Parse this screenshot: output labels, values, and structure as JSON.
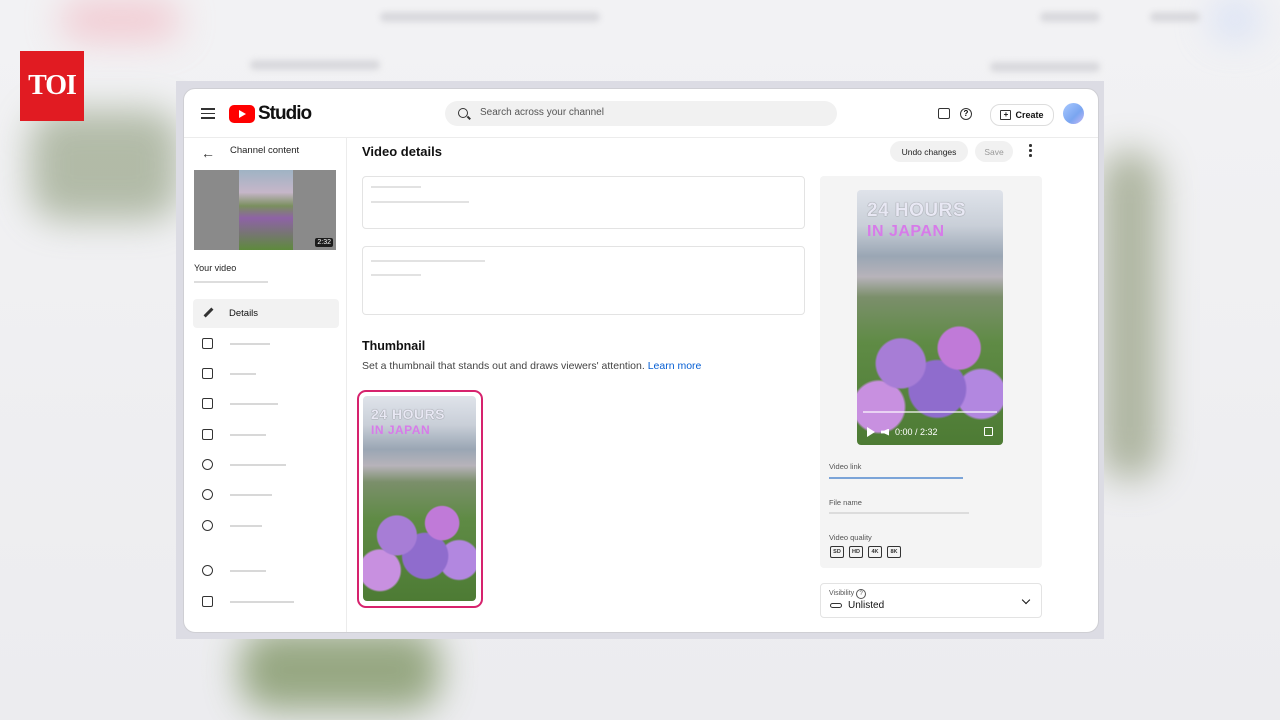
{
  "brand": {
    "logo_text": "TOI",
    "accent": "#e11b22"
  },
  "header": {
    "app_name": "Studio",
    "search_placeholder": "Search across your channel",
    "create_label": "Create"
  },
  "sidebar": {
    "back_label": "Channel content",
    "video_duration": "2:32",
    "your_video_label": "Your video",
    "items": [
      {
        "label": "Details",
        "icon": "pencil-icon",
        "active": true
      },
      {
        "label": "",
        "icon": "analytics-icon"
      },
      {
        "label": "",
        "icon": "editor-icon"
      },
      {
        "label": "",
        "icon": "comments-icon"
      },
      {
        "label": "",
        "icon": "subtitles-icon"
      },
      {
        "label": "",
        "icon": "earn-icon"
      },
      {
        "label": "",
        "icon": "copyright-icon"
      },
      {
        "label": "",
        "icon": "clips-icon"
      },
      {
        "label": "",
        "icon": "settings-icon"
      },
      {
        "label": "",
        "icon": "feedback-icon"
      }
    ]
  },
  "main": {
    "title": "Video details",
    "undo_label": "Undo changes",
    "save_label": "Save",
    "thumbnail_title": "Thumbnail",
    "thumbnail_desc": "Set a thumbnail that stands out and draws viewers' attention.",
    "learn_more": "Learn more",
    "overlay_line1": "24 HOURS",
    "overlay_line2": "IN JAPAN"
  },
  "side_panel": {
    "player_time": "0:00 / 2:32",
    "video_link_label": "Video link",
    "file_name_label": "File name",
    "video_quality_label": "Video quality",
    "qualities": [
      "SD",
      "HD",
      "4K",
      "8K"
    ],
    "visibility_label": "Visibility",
    "visibility_value": "Unlisted"
  }
}
